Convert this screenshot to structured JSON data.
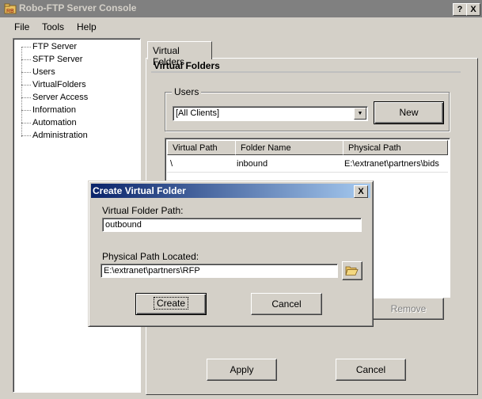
{
  "window": {
    "title": "Robo-FTP Server Console",
    "help_btn": "?",
    "close_btn": "X",
    "icon": "app-icon"
  },
  "menu": [
    "File",
    "Tools",
    "Help"
  ],
  "tree": [
    "FTP Server",
    "SFTP Server",
    "Users",
    "VirtualFolders",
    "Server Access",
    "Information",
    "Automation",
    "Administration"
  ],
  "tab": {
    "label": "Virtual Folders"
  },
  "section": {
    "title": "Virtual Folders"
  },
  "users": {
    "group_label": "Users",
    "selected": "[All Clients]",
    "new_button": "New"
  },
  "table": {
    "columns": [
      "Virtual Path",
      "Folder Name",
      "Physical Path"
    ],
    "rows": [
      [
        "\\",
        "inbound",
        "E:\\extranet\\partners\\bids"
      ]
    ]
  },
  "remove_button": "Remove",
  "apply_button": "Apply",
  "cancel_button": "Cancel",
  "dialog": {
    "title": "Create Virtual Folder",
    "close": "X",
    "virtual_path_label": "Virtual Folder Path:",
    "virtual_path_value": "outbound",
    "physical_path_label": "Physical Path Located:",
    "physical_path_value": "E:\\extranet\\partners\\RFP",
    "browse_icon": "folder-open-icon",
    "create_button": "Create",
    "cancel_button": "Cancel"
  }
}
